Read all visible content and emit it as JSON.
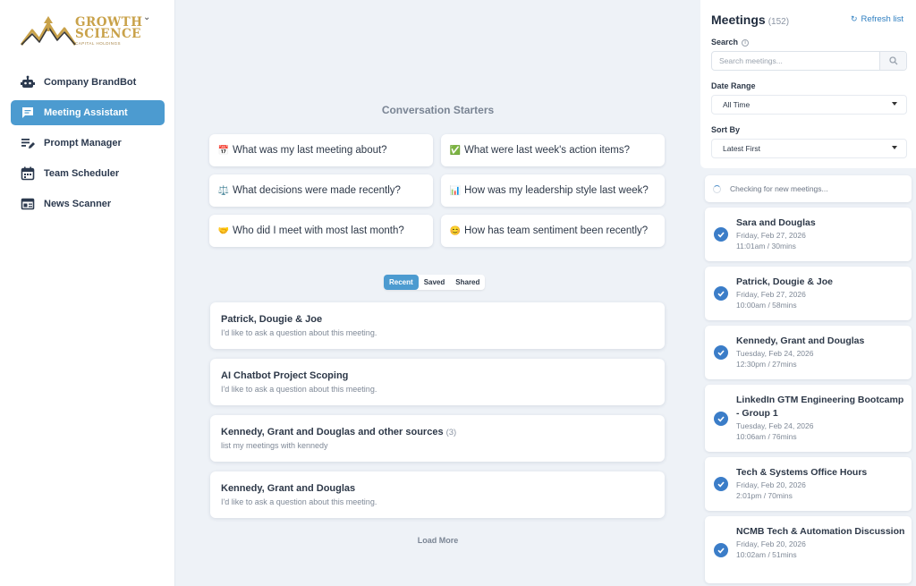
{
  "brand": {
    "line1": "GROWTH",
    "line2": "SCIENCE",
    "sub": "CAPITAL HOLDINGS"
  },
  "nav": [
    {
      "label": "Company BrandBot",
      "icon": "robot-icon",
      "active": false
    },
    {
      "label": "Meeting Assistant",
      "icon": "chat-icon",
      "active": true
    },
    {
      "label": "Prompt Manager",
      "icon": "edit-icon",
      "active": false
    },
    {
      "label": "Team Scheduler",
      "icon": "calendar-icon",
      "active": false
    },
    {
      "label": "News Scanner",
      "icon": "newspaper-icon",
      "active": false
    }
  ],
  "main": {
    "title": "Conversation Starters",
    "starters": [
      {
        "emoji": "📅",
        "text": "What was my last meeting about?"
      },
      {
        "emoji": "✅",
        "text": "What were last week's action items?"
      },
      {
        "emoji": "⚖️",
        "text": "What decisions were made recently?"
      },
      {
        "emoji": "📊",
        "text": "How was my leadership style last week?"
      },
      {
        "emoji": "🤝",
        "text": "Who did I meet with most last month?"
      },
      {
        "emoji": "😊",
        "text": "How has team sentiment been recently?"
      }
    ],
    "tabs": [
      {
        "label": "Recent",
        "active": true
      },
      {
        "label": "Saved",
        "active": false
      },
      {
        "label": "Shared",
        "active": false
      }
    ],
    "conversations": [
      {
        "title": "Patrick, Dougie & Joe",
        "count": "",
        "subtitle": "I'd like to ask a question about this meeting."
      },
      {
        "title": "AI Chatbot Project Scoping",
        "count": "",
        "subtitle": "I'd like to ask a question about this meeting."
      },
      {
        "title": "Kennedy, Grant and Douglas and other sources",
        "count": "(3)",
        "subtitle": "list my meetings with kennedy"
      },
      {
        "title": "Kennedy, Grant and Douglas",
        "count": "",
        "subtitle": "I'd like to ask a question about this meeting."
      }
    ],
    "load_more": "Load More"
  },
  "meetings_panel": {
    "title": "Meetings",
    "count": "(152)",
    "refresh_label": "Refresh list",
    "search_label": "Search",
    "search_placeholder": "Search meetings...",
    "date_range_label": "Date Range",
    "date_range_value": "All Time",
    "sort_label": "Sort By",
    "sort_value": "Latest First",
    "checking_text": "Checking for new meetings...",
    "meetings": [
      {
        "title": "Sara and Douglas",
        "date": "Friday, Feb 27, 2026",
        "time": "11:01am / 30mins"
      },
      {
        "title": "Patrick, Dougie & Joe",
        "date": "Friday, Feb 27, 2026",
        "time": "10:00am / 58mins"
      },
      {
        "title": "Kennedy, Grant and Douglas",
        "date": "Tuesday, Feb 24, 2026",
        "time": "12:30pm / 27mins"
      },
      {
        "title": "LinkedIn GTM Engineering Bootcamp - Group 1",
        "date": "Tuesday, Feb 24, 2026",
        "time": "10:06am / 76mins"
      },
      {
        "title": "Tech & Systems Office Hours",
        "date": "Friday, Feb 20, 2026",
        "time": "2:01pm / 70mins"
      },
      {
        "title": "NCMB Tech & Automation Discussion",
        "date": "Friday, Feb 20, 2026",
        "time": "10:02am / 51mins"
      }
    ]
  },
  "colors": {
    "accent": "#4c9bd0",
    "check": "#3b7dc8",
    "brand_gold": "#c9a24a"
  }
}
